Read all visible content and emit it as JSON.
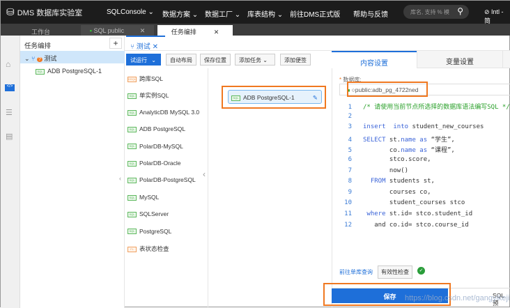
{
  "topbar": {
    "logo": "DMS 数据库实验室",
    "nav": [
      "SQLConsole",
      "数据方案",
      "数据工厂",
      "库表结构",
      "前往DMS正式版",
      "帮助与反馈"
    ],
    "search_placeholder": "库名, 支持 % 模",
    "user": "Intl - 简"
  },
  "window_tabs": [
    {
      "label": "工作台"
    },
    {
      "label": "SQL public"
    },
    {
      "label": "任务编排",
      "active": true
    }
  ],
  "sidebar": {
    "title": "任务编排",
    "add": "+",
    "tree": [
      {
        "label": "测试",
        "badge": "?"
      },
      {
        "label": "ADB PostgreSQL-1"
      }
    ]
  },
  "task_tab": {
    "label": "测试",
    "close": "✕"
  },
  "toolbar": {
    "run": "试运行",
    "auto_layout": "自动布局",
    "save_position": "保存位置",
    "add_task": "添加任务",
    "add_note": "添加便签"
  },
  "palette": [
    {
      "tag": "DSQL",
      "label": "跨库SQL",
      "orange": true
    },
    {
      "tag": "SQL",
      "label": "单实例SQL"
    },
    {
      "tag": "SQL",
      "label": "AnalyticDB MySQL 3.0"
    },
    {
      "tag": "SQL",
      "label": "ADB PostgreSQL"
    },
    {
      "tag": "SQL",
      "label": "PolarDB-MySQL"
    },
    {
      "tag": "SQL",
      "label": "PolarDB-Oracle"
    },
    {
      "tag": "SQL",
      "label": "PolarDB-PostgreSQL"
    },
    {
      "tag": "SQL",
      "label": "MySQL"
    },
    {
      "tag": "SQL",
      "label": "SQLServer"
    },
    {
      "tag": "SQL",
      "label": "PostgreSQL"
    },
    {
      "tag": "FL",
      "label": "表状态检查",
      "orange": true
    }
  ],
  "canvas_node": {
    "tag": "SQL",
    "label": "ADB PostgreSQL-1"
  },
  "right": {
    "tabs": [
      "内容设置",
      "变量设置"
    ],
    "db_label": "数据库:",
    "db_value": "public:adb_pg_4722ned",
    "code": [
      {
        "n": "1",
        "parts": [
          [
            "cm",
            "/* 请使用当前节点所选择的数据库语法编写SQL */"
          ]
        ]
      },
      {
        "n": "2",
        "parts": []
      },
      {
        "n": "3",
        "parts": [
          [
            "kw",
            "insert"
          ],
          [
            "",
            "  "
          ],
          [
            "kw",
            "into"
          ],
          [
            "",
            " student_new_courses"
          ]
        ]
      },
      {
        "n": "4",
        "parts": [
          [
            "kw",
            "SELECT"
          ],
          [
            "",
            " st."
          ],
          [
            "kw",
            "name"
          ],
          [
            "",
            ""
          ],
          [
            "kw",
            " as"
          ],
          [
            "",
            " “学生”,"
          ]
        ]
      },
      {
        "n": "5",
        "parts": [
          [
            "",
            "       co."
          ],
          [
            "kw",
            "name"
          ],
          [
            "kw",
            " as"
          ],
          [
            "",
            " “课程”,"
          ]
        ]
      },
      {
        "n": "6",
        "parts": [
          [
            "",
            "       stco.score,"
          ]
        ]
      },
      {
        "n": "7",
        "parts": [
          [
            "",
            "       now()"
          ]
        ]
      },
      {
        "n": "8",
        "parts": [
          [
            "kw",
            "  FROM"
          ],
          [
            "",
            " students st,"
          ]
        ]
      },
      {
        "n": "9",
        "parts": [
          [
            "",
            "       courses co,"
          ]
        ]
      },
      {
        "n": "10",
        "parts": [
          [
            "",
            "       student_courses stco"
          ]
        ]
      },
      {
        "n": "11",
        "parts": [
          [
            "kw",
            " where"
          ],
          [
            "",
            " st.id= stco.student_id"
          ]
        ]
      },
      {
        "n": "12",
        "parts": [
          [
            "",
            "   and co.id= stco.course_id"
          ]
        ]
      }
    ],
    "link": "前往单库查询",
    "check": "有效性检查",
    "save": "保存",
    "sql_preview": "SQL预"
  },
  "watermark": "https://blog.csdn.net/gangyikeji"
}
